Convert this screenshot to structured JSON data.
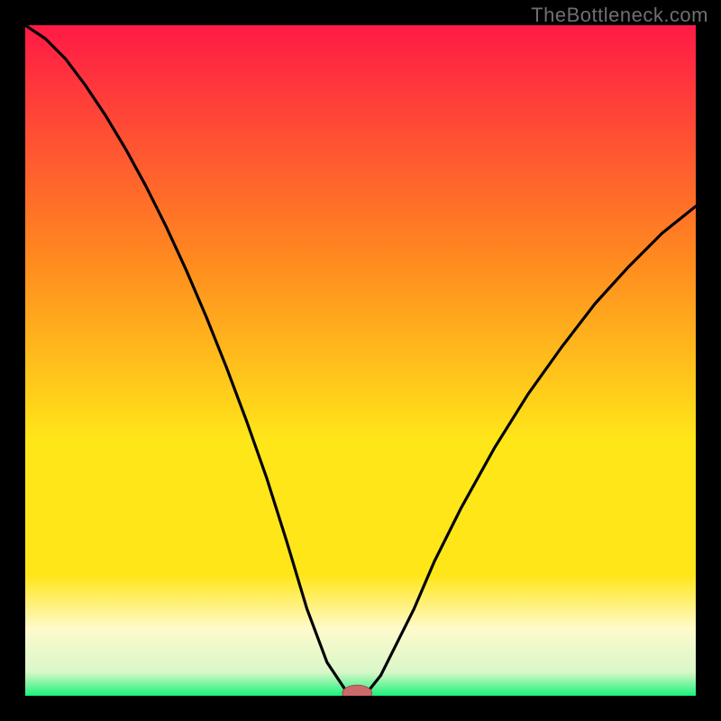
{
  "watermark": "TheBottleneck.com",
  "colors": {
    "background": "#000000",
    "gradient_top": "#ff1a46",
    "gradient_mid1": "#ff8a1f",
    "gradient_mid2": "#ffe619",
    "gradient_mid3": "#fffacc",
    "gradient_bottom": "#19f27a",
    "curve": "#000000",
    "marker_fill": "#cc6a6a",
    "marker_stroke": "#a04d4d"
  },
  "chart_data": {
    "type": "line",
    "title": "",
    "xlabel": "",
    "ylabel": "",
    "xlim": [
      0,
      100
    ],
    "ylim": [
      0,
      100
    ],
    "series": [
      {
        "name": "bottleneck-curve",
        "x": [
          0,
          3,
          6,
          9,
          12,
          15,
          18,
          21,
          24,
          27,
          30,
          33,
          36,
          39,
          42,
          45,
          47,
          48,
          49,
          50,
          51,
          53,
          55,
          58,
          61,
          65,
          70,
          75,
          80,
          85,
          90,
          95,
          100
        ],
        "y": [
          100,
          98,
          95,
          91,
          86.5,
          81.5,
          76,
          70,
          63.5,
          56.5,
          49,
          41,
          32.5,
          23,
          13,
          5,
          2,
          0.5,
          0,
          0,
          0.5,
          3,
          7,
          13,
          20,
          28,
          37,
          45,
          52,
          58.5,
          64,
          69,
          73
        ]
      }
    ],
    "marker": {
      "x": 49.5,
      "y": 0,
      "rx": 2.2,
      "ry": 0.9
    },
    "annotations": []
  }
}
